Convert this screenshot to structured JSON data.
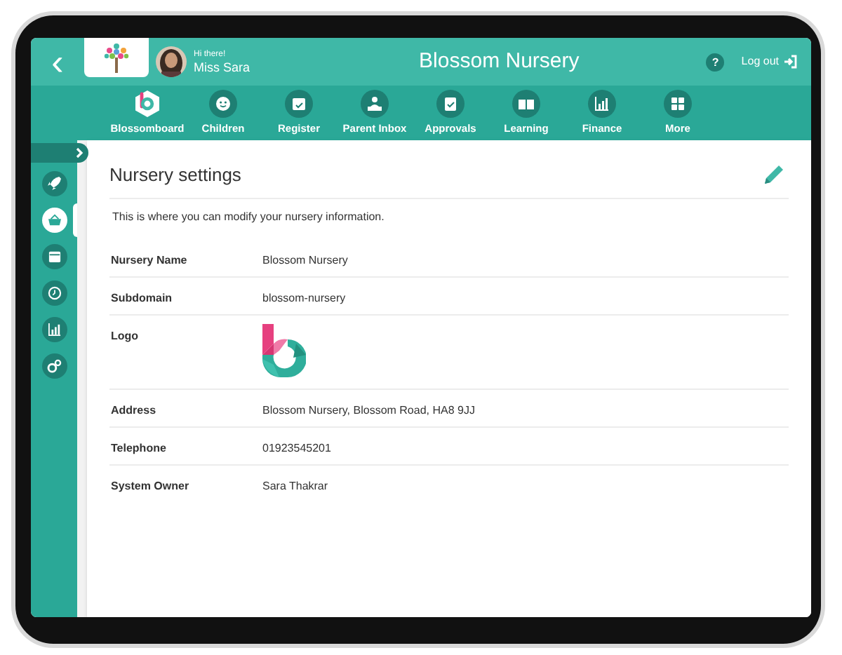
{
  "header": {
    "back": "‹",
    "greeting": "Hi there!",
    "user": "Miss Sara",
    "title": "Blossom Nursery",
    "help": "?",
    "logout": "Log out"
  },
  "nav": [
    {
      "label": "Blossomboard",
      "selected": true
    },
    {
      "label": "Children",
      "selected": false
    },
    {
      "label": "Register",
      "selected": false
    },
    {
      "label": "Parent Inbox",
      "selected": false
    },
    {
      "label": "Approvals",
      "selected": false
    },
    {
      "label": "Learning",
      "selected": false
    },
    {
      "label": "Finance",
      "selected": false
    },
    {
      "label": "More",
      "selected": false
    }
  ],
  "sidebar": {
    "items": [
      {
        "selected": false
      },
      {
        "selected": true
      },
      {
        "selected": false
      },
      {
        "selected": false
      },
      {
        "selected": false
      },
      {
        "selected": false
      }
    ]
  },
  "settings": {
    "title": "Nursery settings",
    "description": "This is where you can modify your nursery information.",
    "rows": [
      {
        "label": "Nursery Name",
        "kind": "text",
        "value": "Blossom Nursery"
      },
      {
        "label": "Subdomain",
        "kind": "text",
        "value": "blossom-nursery"
      },
      {
        "label": "Logo",
        "kind": "logo"
      },
      {
        "label": "Address",
        "kind": "text",
        "value": "Blossom Nursery, Blossom Road, HA8 9JJ"
      },
      {
        "label": "Telephone",
        "kind": "text",
        "value": "01923545201"
      },
      {
        "label": "System Owner",
        "kind": "text",
        "value": "Sara Thakrar"
      }
    ]
  }
}
